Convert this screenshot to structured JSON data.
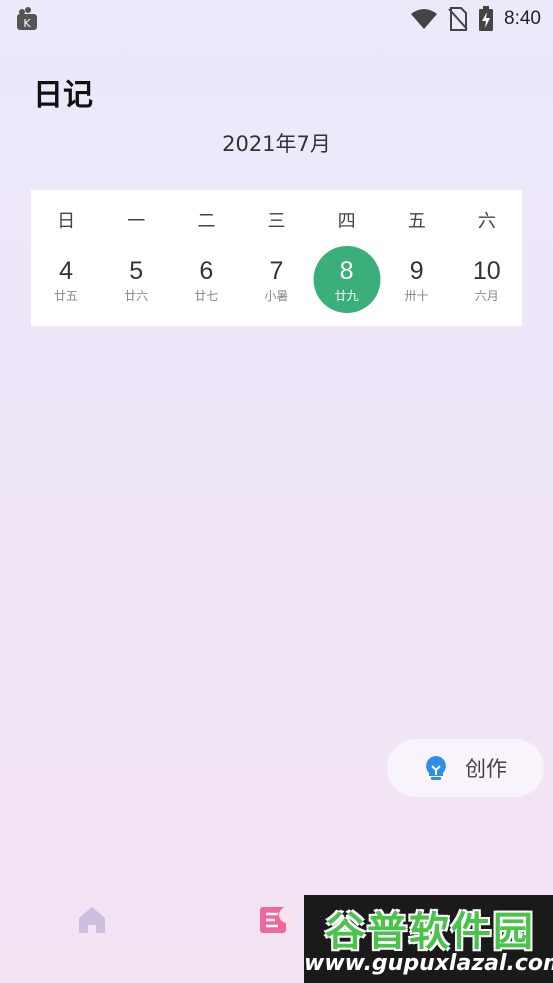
{
  "status_bar": {
    "time": "8:40",
    "icons": [
      "app-notification-icon",
      "wifi-icon",
      "no-sim-icon",
      "battery-charging-icon"
    ]
  },
  "page": {
    "title": "日记",
    "month_label": "2021年7月"
  },
  "calendar": {
    "weekdays": [
      "日",
      "一",
      "二",
      "三",
      "四",
      "五",
      "六"
    ],
    "days": [
      {
        "num": "4",
        "lunar": "廿五"
      },
      {
        "num": "5",
        "lunar": "廿六"
      },
      {
        "num": "6",
        "lunar": "廿七"
      },
      {
        "num": "7",
        "lunar": "小暑"
      },
      {
        "num": "8",
        "lunar": "廿九"
      },
      {
        "num": "9",
        "lunar": "卅十"
      },
      {
        "num": "10",
        "lunar": "六月"
      }
    ],
    "selected_index": 4,
    "selected_color": "#3aaf7a"
  },
  "create_button": {
    "label": "创作",
    "icon": "lightbulb-icon",
    "icon_color": "#2e8fe6"
  },
  "bottom_nav": {
    "items": [
      {
        "icon": "home-icon",
        "color": "#cdbfe0"
      },
      {
        "icon": "diary-icon",
        "color": "#f0679a"
      }
    ]
  },
  "watermark": {
    "logo_text": "谷普软件园",
    "url": "www.gupuxlazal.com"
  }
}
